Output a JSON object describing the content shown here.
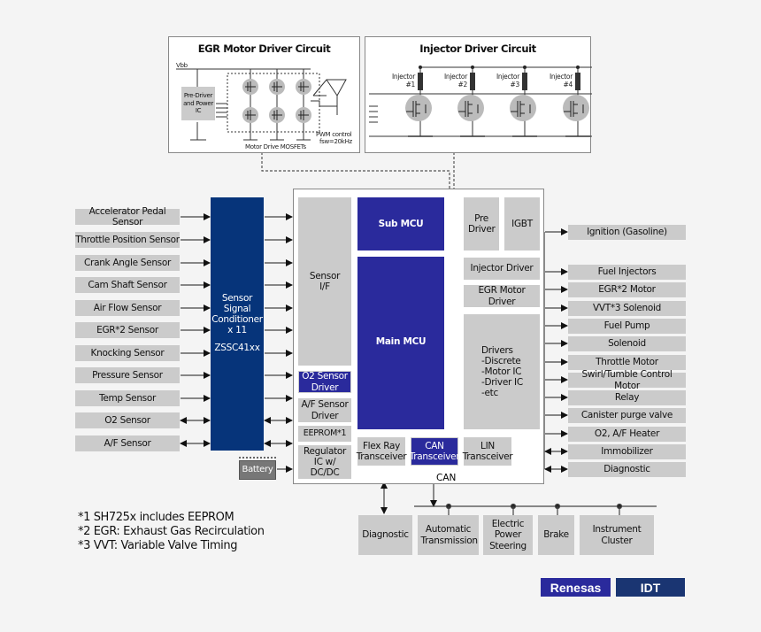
{
  "egr_circuit": {
    "title": "EGR Motor Driver Circuit",
    "vbb_label": "Vbb",
    "predriver_label": "Pre-Driver and Power IC",
    "mosfets_label": "Motor Drive MOSFETs",
    "pwm_label": "PWM control",
    "fsw_label": "fsw=20kHz"
  },
  "injector_circuit": {
    "title": "Injector Driver Circuit",
    "injectors": [
      "Injector #1",
      "Injector #2",
      "Injector #3",
      "Injector #4"
    ]
  },
  "sensors": [
    {
      "label": "Accelerator Pedal Sensor",
      "bidirectional": false
    },
    {
      "label": "Throttle Position Sensor",
      "bidirectional": false
    },
    {
      "label": "Crank Angle Sensor",
      "bidirectional": false
    },
    {
      "label": "Cam Shaft Sensor",
      "bidirectional": false
    },
    {
      "label": "Air Flow Sensor",
      "bidirectional": false
    },
    {
      "label": "EGR*2 Sensor",
      "bidirectional": false
    },
    {
      "label": "Knocking Sensor",
      "bidirectional": false
    },
    {
      "label": "Pressure Sensor",
      "bidirectional": false
    },
    {
      "label": "Temp Sensor",
      "bidirectional": false
    },
    {
      "label": "O2 Sensor",
      "bidirectional": true
    },
    {
      "label": "A/F Sensor",
      "bidirectional": true
    }
  ],
  "conditioner": {
    "line1": "Sensor",
    "line2": "Signal",
    "line3": "Conditioner",
    "line4": "x 11",
    "part": "ZSSC41xx"
  },
  "battery_label": "Battery",
  "ecu": {
    "sensor_if": "Sensor I/F",
    "o2_driver": "O2 Sensor Driver",
    "af_driver": "A/F Sensor Driver",
    "eeprom": "EEPROM*1",
    "regulator": "Regulator IC w/ DC/DC",
    "sub_mcu": "Sub MCU",
    "main_mcu": "Main MCU",
    "pre_driver": "Pre Driver",
    "igbt": "IGBT",
    "injector_driver": "Injector Driver",
    "egr_motor_driver": "EGR Motor Driver",
    "drivers": [
      "Drivers",
      "-Discrete",
      "-Motor IC",
      "-Driver IC",
      "-etc"
    ],
    "flexray": "Flex Ray Transceiver",
    "can": "CAN Transceiver",
    "lin": "LIN Transceiver",
    "can_bus_label": "CAN"
  },
  "outputs": [
    {
      "label": "Ignition (Gasoline)",
      "bidirectional": false
    },
    {
      "label": "Fuel Injectors",
      "bidirectional": false
    },
    {
      "label": "EGR*2 Motor",
      "bidirectional": false
    },
    {
      "label": "VVT*3 Solenoid",
      "bidirectional": false
    },
    {
      "label": "Fuel Pump",
      "bidirectional": false
    },
    {
      "label": "Solenoid",
      "bidirectional": false
    },
    {
      "label": "Throttle Motor",
      "bidirectional": false
    },
    {
      "label": "Swirl/Tumble Control Motor",
      "bidirectional": false
    },
    {
      "label": "Relay",
      "bidirectional": false
    },
    {
      "label": "Canister purge valve",
      "bidirectional": false
    },
    {
      "label": "O2, A/F Heater",
      "bidirectional": false
    },
    {
      "label": "Immobilizer",
      "bidirectional": true
    },
    {
      "label": "Diagnostic",
      "bidirectional": true
    }
  ],
  "bus_nodes": {
    "diagnostic": "Diagnostic",
    "automatic_transmission": "Automatic Transmission",
    "eps": "Electric Power Steering",
    "brake": "Brake",
    "instrument_cluster": "Instrument Cluster"
  },
  "footnotes": [
    "*1 SH725x includes EEPROM",
    "*2 EGR: Exhaust Gas Recirculation",
    "*3 VVT: Variable Valve Timing"
  ],
  "logos": {
    "renesas": "Renesas",
    "idt": "IDT"
  },
  "colors": {
    "mcu_blue": "#2a2a9c",
    "conditioner_navy": "#06347a",
    "block_gray": "#cbcbcb",
    "background": "#f4f4f4"
  }
}
